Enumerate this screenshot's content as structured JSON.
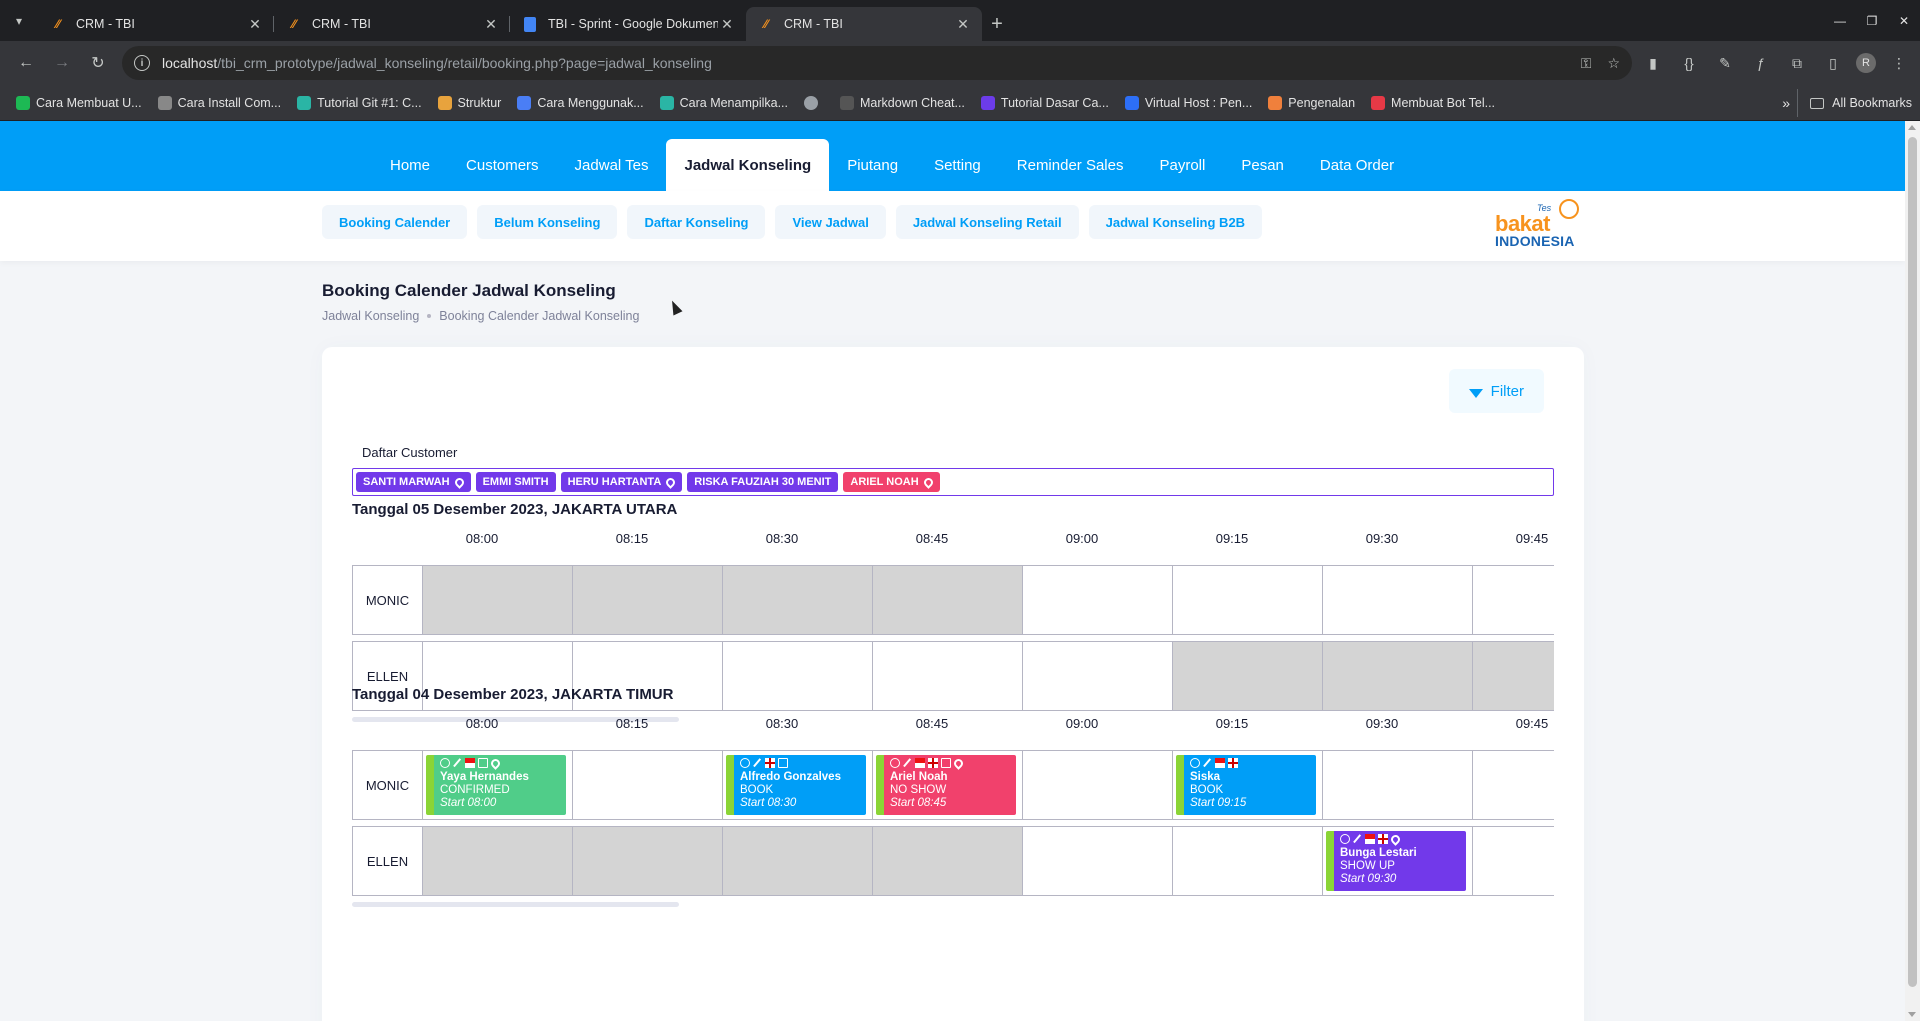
{
  "browser": {
    "tabs": [
      {
        "title": "CRM - TBI",
        "icon": "crm-favicon-icon",
        "active": false
      },
      {
        "title": "CRM - TBI",
        "icon": "crm-favicon-icon",
        "active": false
      },
      {
        "title": "TBI - Sprint - Google Dokumen",
        "icon": "google-docs-icon",
        "active": false
      },
      {
        "title": "CRM - TBI",
        "icon": "crm-favicon-icon",
        "active": true
      }
    ],
    "url_host": "localhost",
    "url_path": "/tbi_crm_prototype/jadwal_konseling/retail/booking.php?page=jadwal_konseling",
    "bookmarks": [
      {
        "label": "Cara Membuat U...",
        "color": "#1db954"
      },
      {
        "label": "Cara Install Com...",
        "color": "#888888"
      },
      {
        "label": "Tutorial Git #1: C...",
        "color": "#2ab5a5"
      },
      {
        "label": "Struktur",
        "color": "#e8a33d"
      },
      {
        "label": "Cara Menggunak...",
        "color": "#4a7ef5"
      },
      {
        "label": "Cara Menampilka...",
        "color": "#2ab5a5"
      },
      {
        "label": "",
        "color": "#9aa0a6"
      },
      {
        "label": "Markdown Cheat...",
        "color": "#555555"
      },
      {
        "label": "Tutorial Dasar Ca...",
        "color": "#6c3ce9"
      },
      {
        "label": "Virtual Host : Pen...",
        "color": "#2d6ff7"
      },
      {
        "label": "Pengenalan",
        "color": "#f0803c"
      },
      {
        "label": "Membuat Bot Tel...",
        "color": "#e63946"
      }
    ],
    "all_bookmarks": "All Bookmarks",
    "profile_initial": "R"
  },
  "topnav": {
    "items": [
      "Home",
      "Customers",
      "Jadwal Tes",
      "Jadwal Konseling",
      "Piutang",
      "Setting",
      "Reminder Sales",
      "Payroll",
      "Pesan",
      "Data Order"
    ],
    "active": "Jadwal Konseling"
  },
  "subnav": {
    "items": [
      "Booking Calender",
      "Belum Konseling",
      "Daftar Konseling",
      "View Jadwal",
      "Jadwal Konseling Retail",
      "Jadwal Konseling B2B"
    ]
  },
  "logo": {
    "tes": "Tes",
    "bakat": "bakat",
    "indonesia": "INDONESIA"
  },
  "page": {
    "title": "Booking Calender Jadwal Konseling",
    "breadcrumb": [
      "Jadwal Konseling",
      "Booking Calender Jadwal Konseling"
    ],
    "filter_label": "Filter"
  },
  "customers": {
    "label": "Daftar Customer",
    "chips": [
      {
        "name": "SANTI MARWAH",
        "color": "#7239ea",
        "pin": true
      },
      {
        "name": "EMMI SMITH",
        "color": "#7239ea",
        "pin": false
      },
      {
        "name": "HERU HARTANTA",
        "color": "#7239ea",
        "pin": true
      },
      {
        "name": "RISKA FAUZIAH 30 MENIT",
        "color": "#7239ea",
        "pin": false
      },
      {
        "name": "ARIEL NOAH",
        "color": "#f1416c",
        "pin": true
      }
    ]
  },
  "schedules": [
    {
      "title": "Tanggal 05 Desember 2023, JAKARTA UTARA",
      "times": [
        "08:00",
        "08:15",
        "08:30",
        "08:45",
        "09:00",
        "09:15",
        "09:30",
        "09:45"
      ],
      "rows": [
        {
          "name": "MONIC",
          "busy": [
            true,
            true,
            true,
            true,
            false,
            false,
            false,
            false
          ],
          "events": []
        },
        {
          "name": "ELLEN",
          "busy": [
            false,
            false,
            false,
            false,
            false,
            true,
            true,
            true
          ],
          "events": []
        }
      ]
    },
    {
      "title": "Tanggal 04 Desember 2023, JAKARTA TIMUR",
      "times": [
        "08:00",
        "08:15",
        "08:30",
        "08:45",
        "09:00",
        "09:15",
        "09:30",
        "09:45"
      ],
      "rows": [
        {
          "name": "MONIC",
          "busy": [
            false,
            false,
            false,
            false,
            false,
            false,
            false,
            false
          ],
          "events": [
            {
              "slot": 0,
              "name": "Yaya Hernandes",
              "status": "CONFIRMED",
              "start": "Start 08:00",
              "color": "#50cd89",
              "icons": [
                "eye-icon",
                "pen-icon",
                "flag-id-icon",
                "id-card-icon",
                "pin-icon"
              ]
            },
            {
              "slot": 2,
              "name": "Alfredo Gonzalves",
              "status": "BOOK",
              "start": "Start 08:30",
              "color": "#009ef7",
              "icons": [
                "eye-icon",
                "pen-icon",
                "flag-en-icon",
                "id-card-icon"
              ]
            },
            {
              "slot": 3,
              "name": "Ariel Noah",
              "status": "NO SHOW",
              "start": "Start 08:45",
              "color": "#f1416c",
              "icons": [
                "eye-icon",
                "pen-icon",
                "flag-id-icon",
                "flag-en-icon",
                "id-card-icon",
                "pin-icon"
              ]
            },
            {
              "slot": 5,
              "name": "Siska",
              "status": "BOOK",
              "start": "Start 09:15",
              "color": "#009ef7",
              "icons": [
                "eye-icon",
                "pen-icon",
                "flag-id-icon",
                "flag-en-icon"
              ]
            }
          ]
        },
        {
          "name": "ELLEN",
          "busy": [
            true,
            true,
            true,
            true,
            false,
            false,
            false,
            false
          ],
          "events": [
            {
              "slot": 6,
              "name": "Bunga Lestari",
              "status": "SHOW UP",
              "start": "Start 09:30",
              "color": "#7239ea",
              "icons": [
                "eye-icon",
                "pen-icon",
                "flag-id-icon",
                "flag-en-icon",
                "pin-icon"
              ]
            }
          ]
        }
      ]
    }
  ]
}
